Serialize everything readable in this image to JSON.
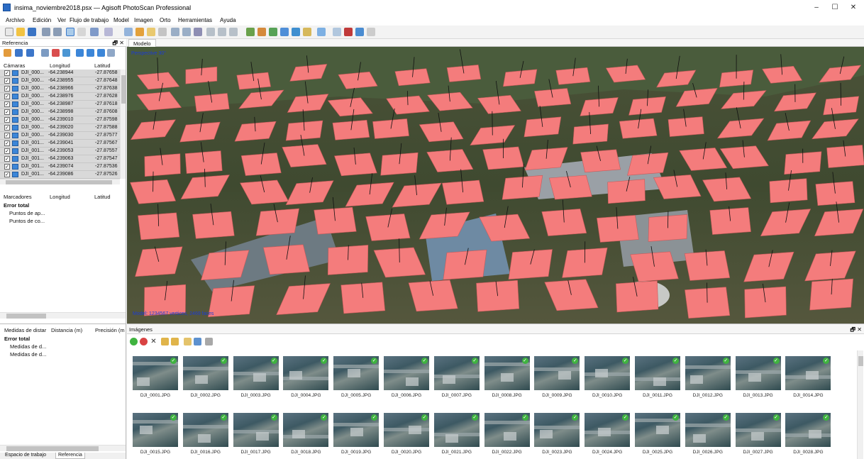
{
  "window": {
    "title": "insima_noviembre2018.psx — Agisoft PhotoScan Professional",
    "minimize": "–",
    "maximize": "☐",
    "close": "✕"
  },
  "menu": [
    "Archivo",
    "Edición",
    "Ver",
    "Flujo de trabajo",
    "Model",
    "Imagen",
    "Orto",
    "Herramientas",
    "Ayuda"
  ],
  "reference_panel": {
    "title": "Referencia",
    "float_close": "🗗 ✕",
    "cameras_header": {
      "name": "Cámaras",
      "lon": "Longitud",
      "lat": "Latitud"
    },
    "cameras": [
      {
        "name": "DJI_000...",
        "lon": "-64.238944",
        "lat": "-27.87658"
      },
      {
        "name": "DJI_000...",
        "lon": "-64.238955",
        "lat": "-27.87648"
      },
      {
        "name": "DJI_000...",
        "lon": "-64.238966",
        "lat": "-27.87638"
      },
      {
        "name": "DJI_000...",
        "lon": "-64.238976",
        "lat": "-27.87628"
      },
      {
        "name": "DJI_000...",
        "lon": "-64.238987",
        "lat": "-27.87618"
      },
      {
        "name": "DJI_000...",
        "lon": "-64.238998",
        "lat": "-27.87608"
      },
      {
        "name": "DJI_000...",
        "lon": "-64.239010",
        "lat": "-27.87598"
      },
      {
        "name": "DJI_000...",
        "lon": "-64.239020",
        "lat": "-27.87588"
      },
      {
        "name": "DJI_000...",
        "lon": "-64.239030",
        "lat": "-27.87577"
      },
      {
        "name": "DJI_001...",
        "lon": "-64.239041",
        "lat": "-27.87567"
      },
      {
        "name": "DJI_001...",
        "lon": "-64.239053",
        "lat": "-27.87557"
      },
      {
        "name": "DJI_001...",
        "lon": "-64.239063",
        "lat": "-27.87547"
      },
      {
        "name": "DJI_001...",
        "lon": "-64.239074",
        "lat": "-27.87536"
      },
      {
        "name": "DJI_001...",
        "lon": "-64.239086",
        "lat": "-27.87526"
      }
    ],
    "markers_header": {
      "name": "Marcadores",
      "lon": "Longitud",
      "lat": "Latitud"
    },
    "markers": {
      "total": "Error total",
      "items": [
        "Puntos de ap...",
        "Puntos de co..."
      ]
    },
    "measures_header": {
      "name": "Medidas de distar",
      "dist": "Distancia (m)",
      "prec": "Precisión (m"
    },
    "measures": {
      "total": "Error total",
      "items": [
        "Medidas de d...",
        "Medidas de d..."
      ]
    }
  },
  "bottom_tabs": [
    "Espacio de trabajo",
    "Referencia"
  ],
  "model": {
    "tab": "Modelo",
    "projection": "Perspective 30°",
    "status": "Model: 1234567 vertices, 2469 faces"
  },
  "images_panel": {
    "title": "Imágenes",
    "float_close": "🗗 ✕",
    "thumbnails": [
      "DJI_0001.JPG",
      "DJI_0002.JPG",
      "DJI_0003.JPG",
      "DJI_0004.JPG",
      "DJI_0005.JPG",
      "DJI_0006.JPG",
      "DJI_0007.JPG",
      "DJI_0008.JPG",
      "DJI_0009.JPG",
      "DJI_0010.JPG",
      "DJI_0011.JPG",
      "DJI_0012.JPG",
      "DJI_0013.JPG",
      "DJI_0014.JPG",
      "DJI_0015.JPG",
      "DJI_0016.JPG",
      "DJI_0017.JPG",
      "DJI_0018.JPG",
      "DJI_0019.JPG",
      "DJI_0020.JPG",
      "DJI_0021.JPG",
      "DJI_0022.JPG",
      "DJI_0023.JPG",
      "DJI_0024.JPG",
      "DJI_0025.JPG",
      "DJI_0026.JPG",
      "DJI_0027.JPG",
      "DJI_0028.JPG"
    ]
  },
  "colors": {
    "camera_plane": "#f47c7c",
    "camera_plane_edge": "#c95a5a",
    "camera_stick": "#111111",
    "viewport_label": "#1b3cd6",
    "selected_row": "#d9d9d9",
    "aligned_tick": "#3fb33f"
  },
  "icons": {
    "toolbar": [
      "new-icon",
      "open-icon",
      "save-icon",
      "undo-icon",
      "redo-icon",
      "select-icon",
      "navigate-icon",
      "rotate-icon",
      "move-icon",
      "ruler-icon",
      "delete-icon",
      "crop-icon",
      "zoom-in-icon",
      "zoom-out-icon",
      "fit-icon",
      "points-icon",
      "dense-icon",
      "mesh-icon",
      "texture-icon",
      "tiled-icon",
      "dem-icon",
      "ortho-icon",
      "camera-icon",
      "grid-icon"
    ]
  }
}
